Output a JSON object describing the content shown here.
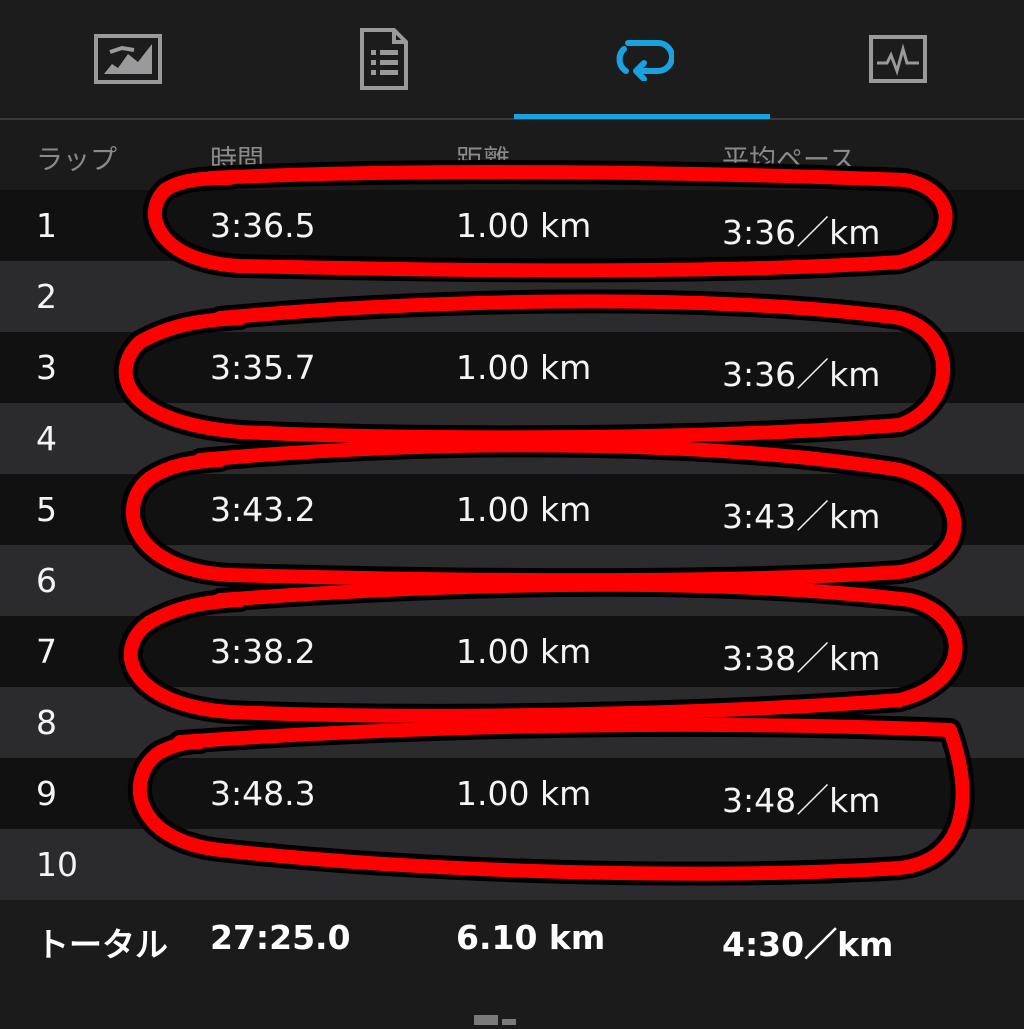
{
  "tabs": [
    {
      "name": "overview",
      "icon": "map-photo-icon",
      "active": false
    },
    {
      "name": "details",
      "icon": "document-list-icon",
      "active": false
    },
    {
      "name": "laps",
      "icon": "loop-arrows-icon",
      "active": true
    },
    {
      "name": "charts",
      "icon": "pulse-chart-icon",
      "active": false
    }
  ],
  "table": {
    "headers": [
      "ラップ",
      "時間",
      "距離",
      "平均ペース"
    ],
    "rows": [
      {
        "lap": "1",
        "time": "3:36.5",
        "distance": "1.00 km",
        "pace": "3:36／km"
      },
      {
        "lap": "2",
        "time": "",
        "distance": "",
        "pace": ""
      },
      {
        "lap": "3",
        "time": "3:35.7",
        "distance": "1.00 km",
        "pace": "3:36／km"
      },
      {
        "lap": "4",
        "time": "",
        "distance": "",
        "pace": ""
      },
      {
        "lap": "5",
        "time": "3:43.2",
        "distance": "1.00 km",
        "pace": "3:43／km"
      },
      {
        "lap": "6",
        "time": "",
        "distance": "",
        "pace": ""
      },
      {
        "lap": "7",
        "time": "3:38.2",
        "distance": "1.00 km",
        "pace": "3:38／km"
      },
      {
        "lap": "8",
        "time": "",
        "distance": "",
        "pace": ""
      },
      {
        "lap": "9",
        "time": "3:48.3",
        "distance": "1.00 km",
        "pace": "3:48／km"
      },
      {
        "lap": "10",
        "time": "",
        "distance": "",
        "pace": ""
      }
    ],
    "total": {
      "label": "トータル",
      "time": "27:25.0",
      "distance": "6.10 km",
      "pace": "4:30／km"
    }
  },
  "colors": {
    "accent": "#19a2e0",
    "annotation": "#ff0000",
    "row_dark": "#111112",
    "row_light": "#2b2b2d"
  }
}
